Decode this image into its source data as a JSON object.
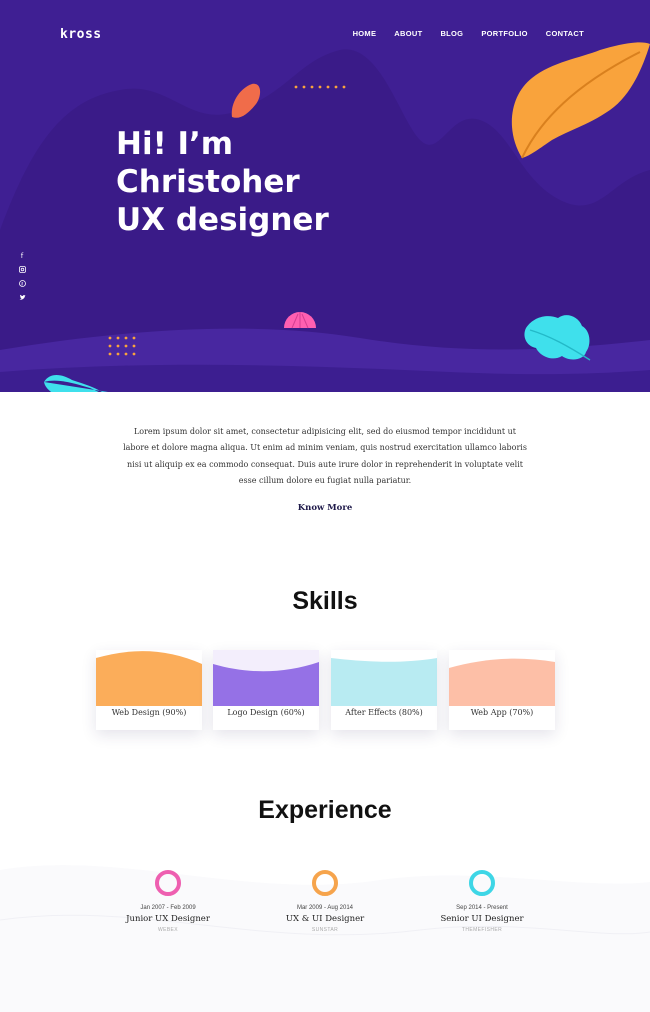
{
  "header": {
    "logo": "kross",
    "nav": [
      "HOME",
      "ABOUT",
      "BLOG",
      "PORTFOLIO",
      "CONTACT"
    ]
  },
  "hero": {
    "title_lines": [
      "Hi! I’m",
      "Christoher",
      "UX designer"
    ],
    "social_icons": [
      "facebook-icon",
      "instagram-icon",
      "pinterest-icon",
      "twitter-icon"
    ],
    "colors": {
      "background": "#3f1f93",
      "shape": "#3a1b88",
      "leaf_orange": "#f9a33c",
      "leaf_cyan": "#3fe0ec",
      "accent_pink": "#ff5fb1"
    }
  },
  "intro": {
    "text": "Lorem ipsum dolor sit amet, consectetur adipisicing elit, sed do eiusmod tempor incididunt ut labore et dolore magna aliqua. Ut enim ad minim veniam, quis nostrud exercitation ullamco laboris nisi ut aliquip ex ea commodo consequat. Duis aute irure dolor in reprehenderit in voluptate velit esse cillum dolore eu fugiat nulla pariatur.",
    "cta": "Know More"
  },
  "skills": {
    "title": "Skills",
    "items": [
      {
        "label": "Web Design (90%)",
        "color": "#fbad5a"
      },
      {
        "label": "Logo Design (60%)",
        "color": "#9571e6"
      },
      {
        "label": "After Effects (80%)",
        "color": "#b8ebf2"
      },
      {
        "label": "Web App (70%)",
        "color": "#fdbfa7"
      }
    ]
  },
  "experience": {
    "title": "Experience",
    "items": [
      {
        "date": "Jan 2007 - Feb 2009",
        "role": "Junior UX Designer",
        "company": "WEBEX",
        "color": "#ee5fb0"
      },
      {
        "date": "Mar 2009 - Aug 2014",
        "role": "UX & UI Designer",
        "company": "SUNSTAR",
        "color": "#f6a44c"
      },
      {
        "date": "Sep 2014 - Present",
        "role": "Senior UI Designer",
        "company": "THEMEFISHER",
        "color": "#3ed6e6"
      }
    ]
  }
}
